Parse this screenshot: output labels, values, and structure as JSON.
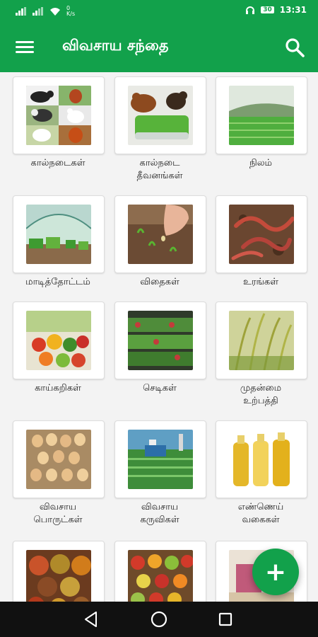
{
  "statusbar": {
    "net_speed": "0\nK/s",
    "battery": "30",
    "time": "13:31"
  },
  "toolbar": {
    "title": "விவசாய சந்தை"
  },
  "categories": [
    {
      "label_line1": "கால்நடைகள்",
      "label_line2": ""
    },
    {
      "label_line1": "கால்நடை",
      "label_line2": "தீவனங்கள்"
    },
    {
      "label_line1": "நிலம்",
      "label_line2": ""
    },
    {
      "label_line1": "மாடித்தோட்டம்",
      "label_line2": ""
    },
    {
      "label_line1": "விதைகள்",
      "label_line2": ""
    },
    {
      "label_line1": "உரங்கள்",
      "label_line2": ""
    },
    {
      "label_line1": "காய்கறிகள்",
      "label_line2": ""
    },
    {
      "label_line1": "செடிகள்",
      "label_line2": ""
    },
    {
      "label_line1": "முதன்மை",
      "label_line2": "உற்பத்தி"
    },
    {
      "label_line1": "விவசாய",
      "label_line2": "பொருட்கள்"
    },
    {
      "label_line1": "விவசாய",
      "label_line2": "கருவிகள்"
    },
    {
      "label_line1": "எண்ணெய்",
      "label_line2": "வகைகள்"
    }
  ],
  "fab": {
    "label": "+"
  }
}
